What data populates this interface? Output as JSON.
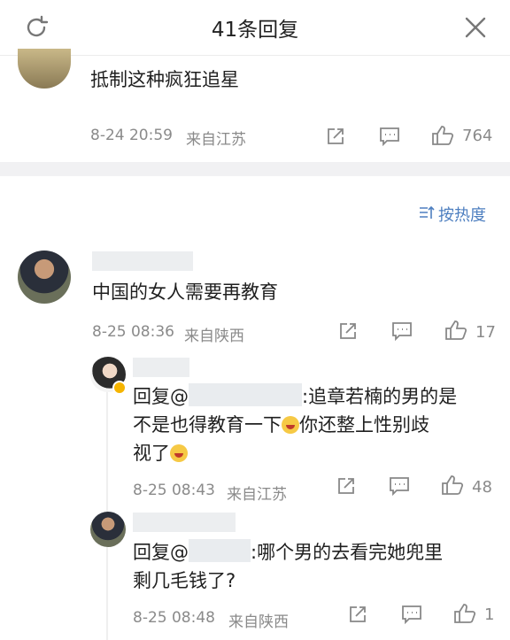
{
  "header": {
    "title": "41条回复",
    "refresh_icon": "refresh-icon",
    "close_icon": "close-icon"
  },
  "main_comment": {
    "text": "抵制这种疯狂追星",
    "time": "8-24 20:59",
    "location": "来自江苏",
    "likes": "764"
  },
  "sort": {
    "label": "按热度",
    "icon": "sort-icon"
  },
  "comments": [
    {
      "text": "中国的女人需要再教育",
      "time": "8-25 08:36",
      "location": "来自陕西",
      "likes": "17"
    }
  ],
  "replies": [
    {
      "prefix": "回复@",
      "line1_after": ":追章若楠的男的是",
      "line2_before": "不是也得教育一下",
      "line2_after": "你还整上性别歧",
      "line3": "视了",
      "time": "8-25 08:43",
      "location": "来自江苏",
      "likes": "48"
    },
    {
      "prefix": "回复@",
      "line1_after": ":哪个男的去看完她兜里",
      "line2": "剩几毛钱了?",
      "time": "8-25 08:48",
      "location": "来自陕西",
      "likes": "1"
    }
  ],
  "colors": {
    "accent": "#4e7fc0",
    "meta": "#8a8a8a",
    "band": "#f1f1f3"
  }
}
